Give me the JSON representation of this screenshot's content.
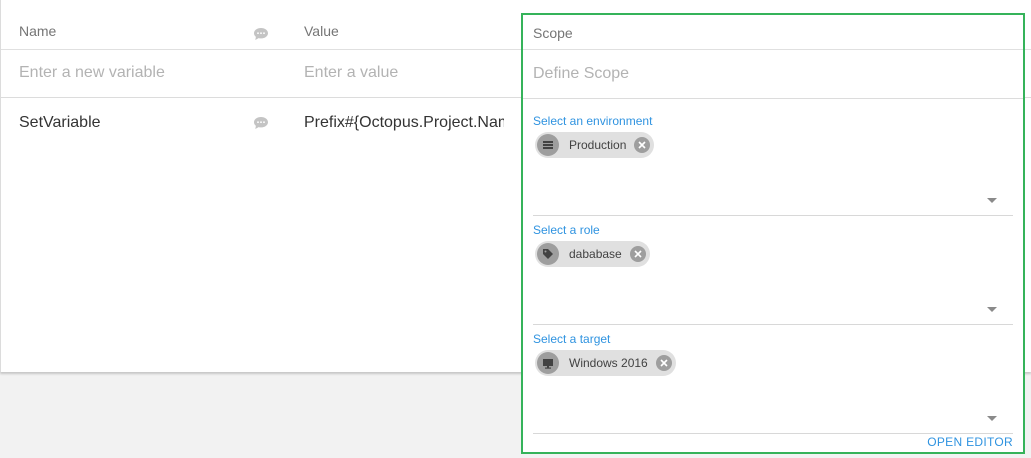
{
  "table": {
    "headers": {
      "name": "Name",
      "value": "Value"
    },
    "placeholders": {
      "name": "Enter a new variable",
      "value": "Enter a value"
    },
    "rows": [
      {
        "name": "SetVariable",
        "value": "Prefix#{Octopus.Project.Name}"
      }
    ]
  },
  "scope": {
    "header": "Scope",
    "placeholder": "Define Scope",
    "fields": [
      {
        "label": "Select an environment",
        "chip": "Production",
        "chip_icon": "list-icon"
      },
      {
        "label": "Select a role",
        "chip": "dababase",
        "chip_icon": "tag-icon"
      },
      {
        "label": "Select a target",
        "chip": "Windows 2016",
        "chip_icon": "monitor-icon"
      }
    ],
    "open_editor": "OPEN EDITOR"
  },
  "colors": {
    "accent": "#2f93e0",
    "focus_border": "#35b35a",
    "chip_bg": "#e0e0e0",
    "chip_icon_bg": "#9e9e9e"
  }
}
